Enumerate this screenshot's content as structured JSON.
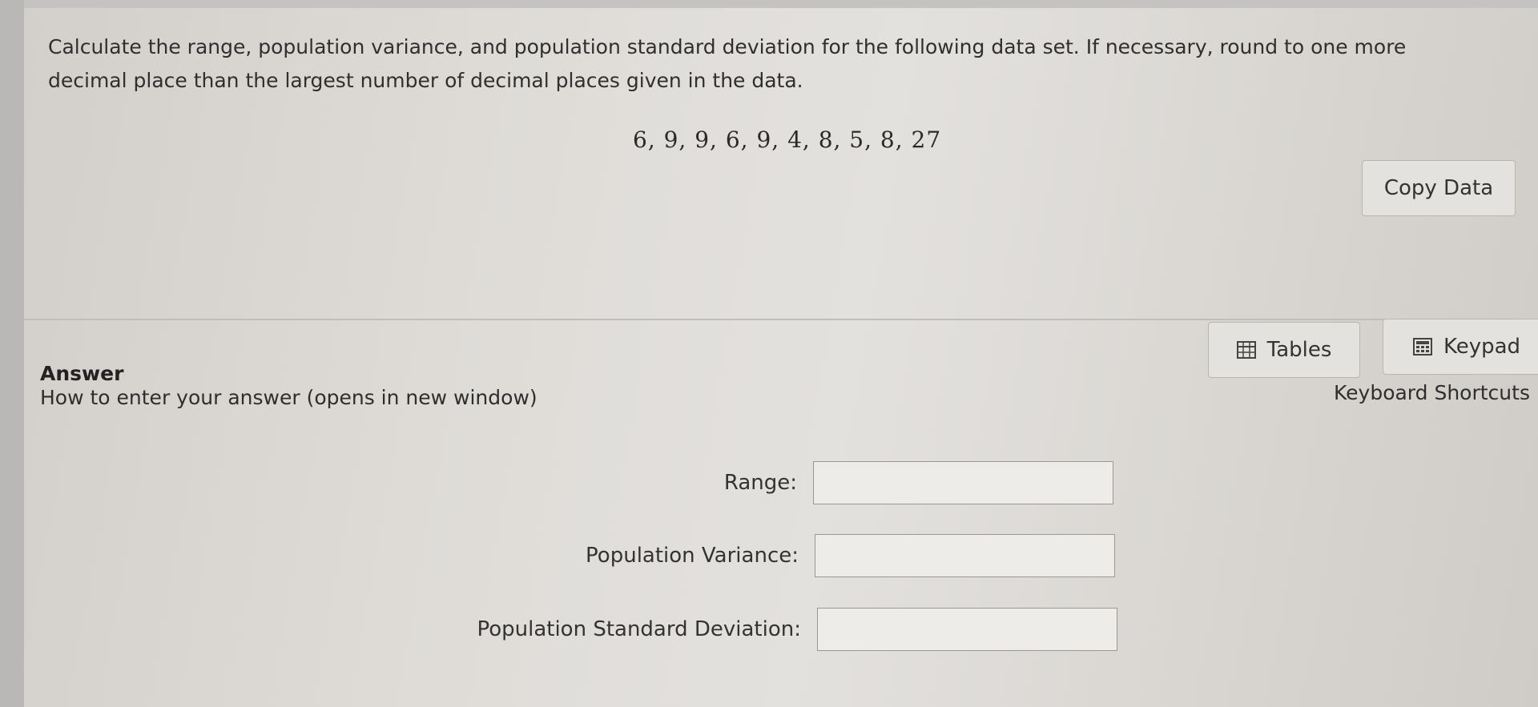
{
  "question": {
    "prompt": "Calculate the range, population variance, and population standard deviation for the following data set. If necessary, round to one more decimal place than the largest number of decimal places given in the data.",
    "data_set": "6, 9, 9, 6, 9, 4, 8, 5, 8, 27"
  },
  "toolbar": {
    "copy_data_label": "Copy Data",
    "tables_label": "Tables",
    "keypad_label": "Keypad",
    "keyboard_shortcuts_label": "Keyboard Shortcuts"
  },
  "answer": {
    "heading": "Answer",
    "help_link": "How to enter your answer (opens in new window)",
    "fields": [
      {
        "label": "Range:",
        "value": ""
      },
      {
        "label": "Population Variance:",
        "value": ""
      },
      {
        "label": "Population Standard Deviation:",
        "value": ""
      }
    ]
  },
  "icons": {
    "tables": "table-grid-icon",
    "keypad": "calculator-icon"
  }
}
